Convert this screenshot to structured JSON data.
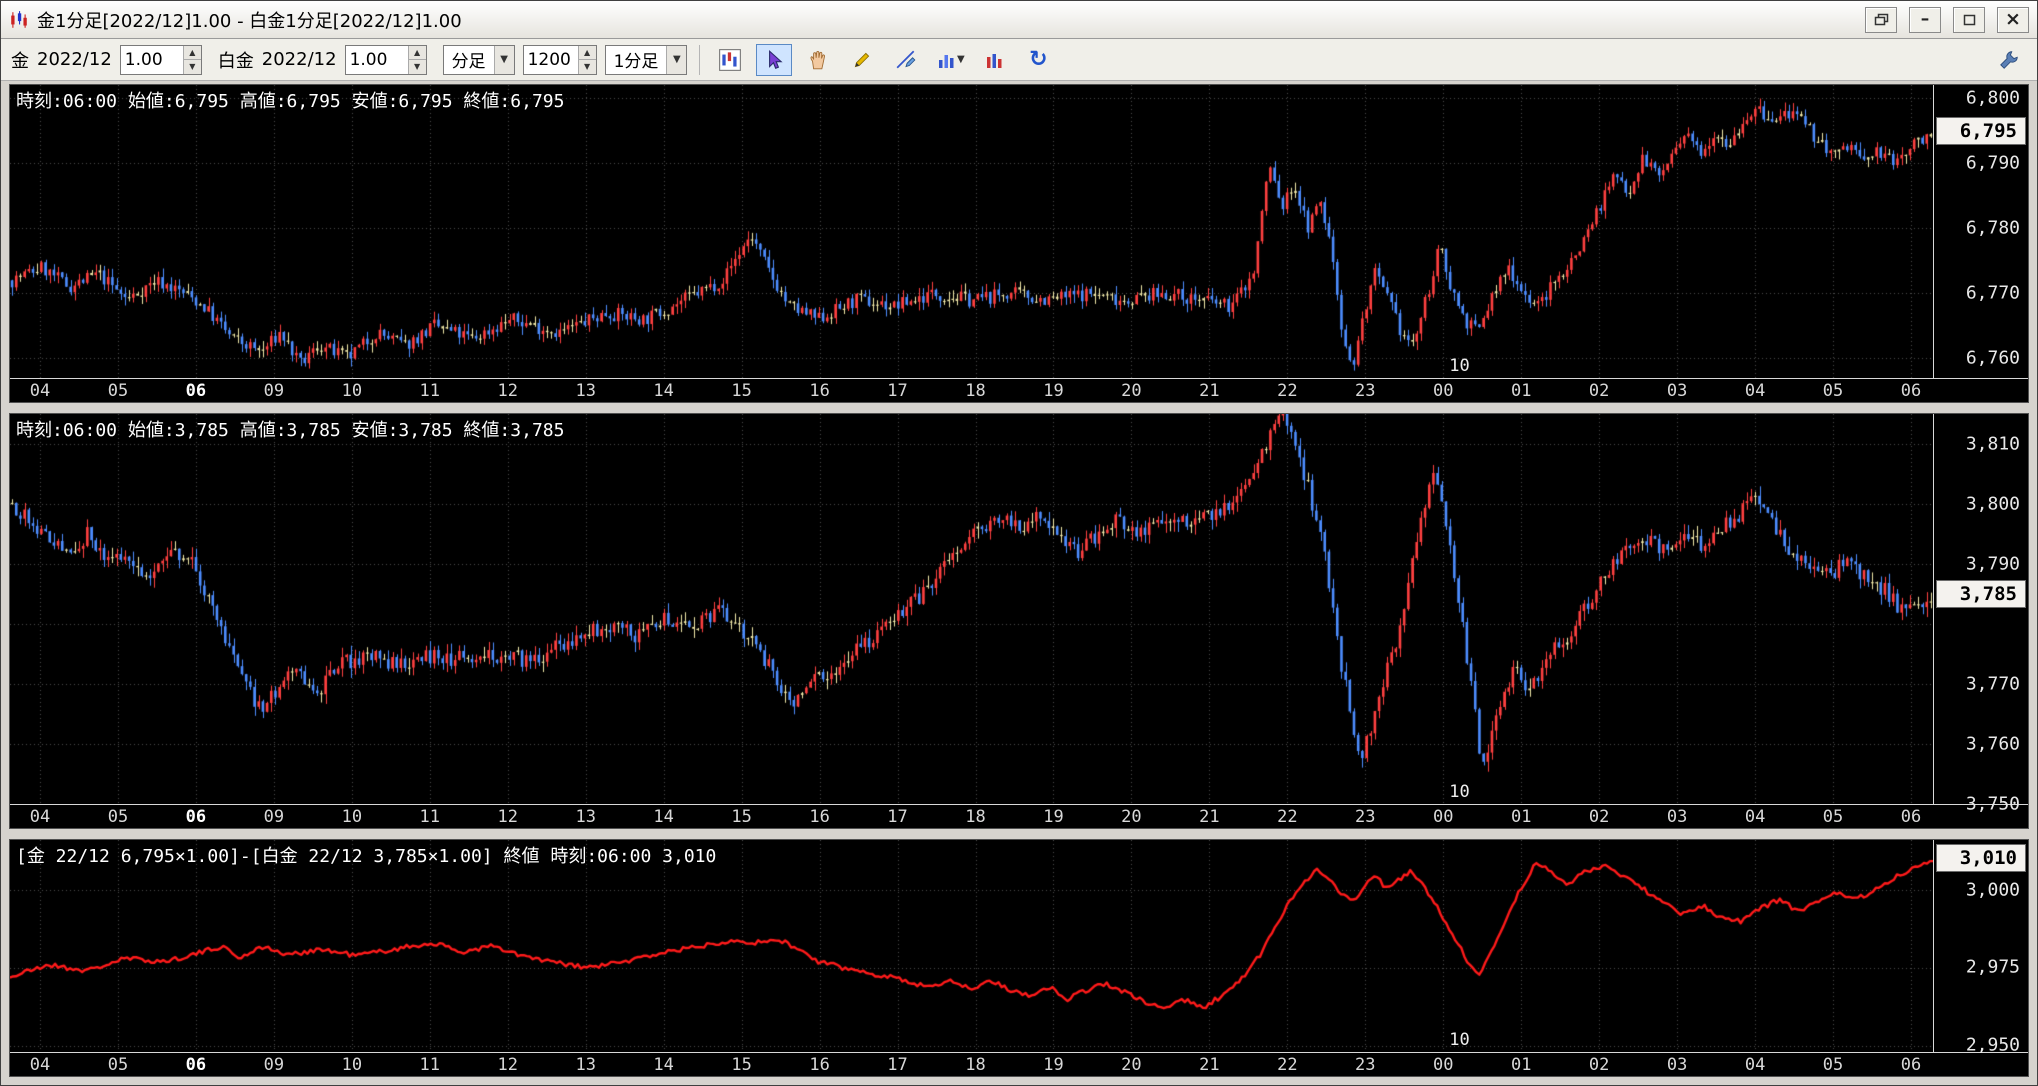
{
  "window": {
    "title": "金1分足[2022/12]1.00 - 白金1分足[2022/12]1.00"
  },
  "icons": {
    "caret_down": "▼",
    "spin_up": "▲",
    "spin_down": "▼",
    "refresh": "↻",
    "minimize": "–",
    "close": "×"
  },
  "toolbar": {
    "gold_label": "金",
    "gold_month": "2022/12",
    "gold_multiplier": "1.00",
    "platinum_label": "白金",
    "platinum_month": "2022/12",
    "platinum_multiplier": "1.00",
    "bar_type": "分足",
    "bar_count": "1200",
    "bar_interval": "1分足"
  },
  "colors": {
    "candle_up": "#ff4040",
    "candle_down": "#4d8dff",
    "candle_flat": "#f0e8a8",
    "spread_line": "#ff1a1a",
    "grid": "#4d4d4d",
    "panel_bg": "#000000",
    "marker_bg": "#f4f2ee",
    "selected_tool_bg": "#cfe4ff"
  },
  "x_axis": {
    "labels": [
      "04",
      "05",
      "06",
      "09",
      "10",
      "11",
      "12",
      "13",
      "14",
      "15",
      "16",
      "17",
      "18",
      "19",
      "20",
      "21",
      "22",
      "23",
      "00",
      "01",
      "02",
      "03",
      "04",
      "05",
      "06"
    ],
    "emphasized_index": 2,
    "date_marker": {
      "label": "10",
      "index": 18
    }
  },
  "chart_data": [
    {
      "id": "gold",
      "type": "candlestick",
      "title_info": "時刻:06:00 始値:6,795 高値:6,795 安値:6,795 終値:6,795",
      "y_ticks": [
        6800,
        6790,
        6780,
        6770,
        6760
      ],
      "grid_values": [
        6800,
        6790,
        6780,
        6770,
        6760
      ],
      "y_range": [
        6757,
        6802
      ],
      "last_price": 6795,
      "last_price_label": "6,795",
      "candle_count": 460,
      "noise": 1.1,
      "seed": 7,
      "keypoints": [
        [
          0,
          6772
        ],
        [
          0.015,
          6774
        ],
        [
          0.03,
          6771
        ],
        [
          0.045,
          6773
        ],
        [
          0.06,
          6769
        ],
        [
          0.075,
          6772
        ],
        [
          0.09,
          6770
        ],
        [
          0.1,
          6768
        ],
        [
          0.115,
          6763
        ],
        [
          0.13,
          6761
        ],
        [
          0.14,
          6764
        ],
        [
          0.15,
          6759
        ],
        [
          0.16,
          6762
        ],
        [
          0.175,
          6760
        ],
        [
          0.19,
          6764
        ],
        [
          0.205,
          6762
        ],
        [
          0.22,
          6765
        ],
        [
          0.24,
          6763
        ],
        [
          0.26,
          6766
        ],
        [
          0.285,
          6764
        ],
        [
          0.31,
          6767
        ],
        [
          0.33,
          6766
        ],
        [
          0.35,
          6769
        ],
        [
          0.37,
          6772
        ],
        [
          0.385,
          6779
        ],
        [
          0.395,
          6773
        ],
        [
          0.405,
          6768
        ],
        [
          0.42,
          6766
        ],
        [
          0.44,
          6769
        ],
        [
          0.46,
          6768
        ],
        [
          0.48,
          6770
        ],
        [
          0.5,
          6769
        ],
        [
          0.52,
          6770
        ],
        [
          0.54,
          6769
        ],
        [
          0.56,
          6770
        ],
        [
          0.58,
          6769
        ],
        [
          0.6,
          6770
        ],
        [
          0.62,
          6769
        ],
        [
          0.635,
          6768
        ],
        [
          0.647,
          6773
        ],
        [
          0.655,
          6790
        ],
        [
          0.662,
          6783
        ],
        [
          0.668,
          6787
        ],
        [
          0.675,
          6780
        ],
        [
          0.682,
          6784
        ],
        [
          0.688,
          6776
        ],
        [
          0.693,
          6765
        ],
        [
          0.698,
          6758
        ],
        [
          0.704,
          6766
        ],
        [
          0.71,
          6773
        ],
        [
          0.717,
          6769
        ],
        [
          0.724,
          6764
        ],
        [
          0.73,
          6762
        ],
        [
          0.737,
          6769
        ],
        [
          0.744,
          6777
        ],
        [
          0.75,
          6771
        ],
        [
          0.757,
          6766
        ],
        [
          0.764,
          6764
        ],
        [
          0.772,
          6770
        ],
        [
          0.78,
          6774
        ],
        [
          0.788,
          6770
        ],
        [
          0.795,
          6768
        ],
        [
          0.805,
          6772
        ],
        [
          0.815,
          6776
        ],
        [
          0.825,
          6782
        ],
        [
          0.835,
          6788
        ],
        [
          0.843,
          6786
        ],
        [
          0.85,
          6791
        ],
        [
          0.858,
          6788
        ],
        [
          0.865,
          6791
        ],
        [
          0.872,
          6794
        ],
        [
          0.88,
          6792
        ],
        [
          0.888,
          6795
        ],
        [
          0.895,
          6793
        ],
        [
          0.903,
          6797
        ],
        [
          0.91,
          6798
        ],
        [
          0.918,
          6796
        ],
        [
          0.925,
          6798
        ],
        [
          0.933,
          6796
        ],
        [
          0.94,
          6794
        ],
        [
          0.95,
          6791
        ],
        [
          0.958,
          6793
        ],
        [
          0.965,
          6790
        ],
        [
          0.972,
          6792
        ],
        [
          0.98,
          6790
        ],
        [
          0.988,
          6792
        ],
        [
          1,
          6795
        ]
      ]
    },
    {
      "id": "platinum",
      "type": "candlestick",
      "title_info": "時刻:06:00 始値:3,785 高値:3,785 安値:3,785 終値:3,785",
      "y_ticks": [
        3810,
        3800,
        3790,
        3770,
        3760,
        3750
      ],
      "grid_values": [
        3810,
        3800,
        3790,
        3780,
        3770,
        3760,
        3750
      ],
      "y_range": [
        3750,
        3815
      ],
      "last_price": 3785,
      "last_price_label": "3,785",
      "candle_count": 460,
      "noise": 1.4,
      "seed": 13,
      "keypoints": [
        [
          0,
          3800
        ],
        [
          0.01,
          3797
        ],
        [
          0.02,
          3794
        ],
        [
          0.03,
          3792
        ],
        [
          0.04,
          3795
        ],
        [
          0.05,
          3790
        ],
        [
          0.06,
          3792
        ],
        [
          0.07,
          3788
        ],
        [
          0.08,
          3791
        ],
        [
          0.09,
          3792
        ],
        [
          0.1,
          3786
        ],
        [
          0.11,
          3778
        ],
        [
          0.12,
          3771
        ],
        [
          0.13,
          3765
        ],
        [
          0.14,
          3770
        ],
        [
          0.15,
          3772
        ],
        [
          0.16,
          3769
        ],
        [
          0.17,
          3773
        ],
        [
          0.185,
          3775
        ],
        [
          0.2,
          3773
        ],
        [
          0.215,
          3775
        ],
        [
          0.23,
          3774
        ],
        [
          0.25,
          3775
        ],
        [
          0.27,
          3774
        ],
        [
          0.29,
          3777
        ],
        [
          0.31,
          3780
        ],
        [
          0.325,
          3778
        ],
        [
          0.34,
          3781
        ],
        [
          0.355,
          3780
        ],
        [
          0.37,
          3782
        ],
        [
          0.38,
          3779
        ],
        [
          0.39,
          3775
        ],
        [
          0.4,
          3770
        ],
        [
          0.407,
          3766
        ],
        [
          0.415,
          3770
        ],
        [
          0.43,
          3773
        ],
        [
          0.445,
          3777
        ],
        [
          0.46,
          3781
        ],
        [
          0.475,
          3785
        ],
        [
          0.49,
          3791
        ],
        [
          0.505,
          3796
        ],
        [
          0.515,
          3798
        ],
        [
          0.525,
          3796
        ],
        [
          0.535,
          3798
        ],
        [
          0.545,
          3794
        ],
        [
          0.555,
          3792
        ],
        [
          0.565,
          3795
        ],
        [
          0.575,
          3797
        ],
        [
          0.585,
          3795
        ],
        [
          0.6,
          3798
        ],
        [
          0.615,
          3797
        ],
        [
          0.63,
          3799
        ],
        [
          0.64,
          3802
        ],
        [
          0.65,
          3807
        ],
        [
          0.657,
          3812
        ],
        [
          0.663,
          3815
        ],
        [
          0.67,
          3808
        ],
        [
          0.677,
          3801
        ],
        [
          0.684,
          3792
        ],
        [
          0.69,
          3778
        ],
        [
          0.697,
          3766
        ],
        [
          0.703,
          3758
        ],
        [
          0.71,
          3765
        ],
        [
          0.717,
          3773
        ],
        [
          0.724,
          3780
        ],
        [
          0.73,
          3790
        ],
        [
          0.736,
          3800
        ],
        [
          0.741,
          3806
        ],
        [
          0.747,
          3798
        ],
        [
          0.753,
          3786
        ],
        [
          0.76,
          3770
        ],
        [
          0.766,
          3757
        ],
        [
          0.772,
          3762
        ],
        [
          0.778,
          3769
        ],
        [
          0.784,
          3773
        ],
        [
          0.79,
          3769
        ],
        [
          0.8,
          3774
        ],
        [
          0.81,
          3778
        ],
        [
          0.82,
          3783
        ],
        [
          0.83,
          3788
        ],
        [
          0.84,
          3792
        ],
        [
          0.85,
          3795
        ],
        [
          0.86,
          3792
        ],
        [
          0.87,
          3795
        ],
        [
          0.88,
          3793
        ],
        [
          0.89,
          3796
        ],
        [
          0.9,
          3798
        ],
        [
          0.908,
          3801
        ],
        [
          0.916,
          3797
        ],
        [
          0.925,
          3793
        ],
        [
          0.935,
          3790
        ],
        [
          0.945,
          3788
        ],
        [
          0.955,
          3790
        ],
        [
          0.965,
          3788
        ],
        [
          0.975,
          3786
        ],
        [
          0.985,
          3782
        ],
        [
          1,
          3785
        ]
      ]
    },
    {
      "id": "spread",
      "type": "line",
      "title_info": "[金 22/12 6,795×1.00]-[白金 22/12 3,785×1.00] 終値 時刻:06:00 3,010",
      "y_ticks": [
        3000,
        2975,
        2950
      ],
      "grid_values": [
        3000,
        2975,
        2950
      ],
      "y_range": [
        2948,
        3016
      ],
      "last_price": 3010,
      "last_price_label": "3,010",
      "noise": 0.8,
      "seed": 21,
      "keypoints": [
        [
          0,
          2972
        ],
        [
          0.02,
          2976
        ],
        [
          0.04,
          2974
        ],
        [
          0.06,
          2978
        ],
        [
          0.08,
          2977
        ],
        [
          0.1,
          2980
        ],
        [
          0.11,
          2982
        ],
        [
          0.12,
          2978
        ],
        [
          0.13,
          2982
        ],
        [
          0.145,
          2979
        ],
        [
          0.16,
          2981
        ],
        [
          0.18,
          2979
        ],
        [
          0.2,
          2981
        ],
        [
          0.22,
          2983
        ],
        [
          0.235,
          2980
        ],
        [
          0.25,
          2982
        ],
        [
          0.265,
          2979
        ],
        [
          0.28,
          2977
        ],
        [
          0.3,
          2975
        ],
        [
          0.32,
          2977
        ],
        [
          0.34,
          2980
        ],
        [
          0.36,
          2982
        ],
        [
          0.375,
          2984
        ],
        [
          0.39,
          2983
        ],
        [
          0.4,
          2984
        ],
        [
          0.41,
          2981
        ],
        [
          0.42,
          2977
        ],
        [
          0.44,
          2974
        ],
        [
          0.46,
          2972
        ],
        [
          0.475,
          2969
        ],
        [
          0.49,
          2971
        ],
        [
          0.5,
          2968
        ],
        [
          0.51,
          2971
        ],
        [
          0.52,
          2968
        ],
        [
          0.53,
          2966
        ],
        [
          0.54,
          2969
        ],
        [
          0.55,
          2965
        ],
        [
          0.56,
          2968
        ],
        [
          0.57,
          2970
        ],
        [
          0.58,
          2967
        ],
        [
          0.59,
          2964
        ],
        [
          0.6,
          2962
        ],
        [
          0.61,
          2965
        ],
        [
          0.62,
          2962
        ],
        [
          0.63,
          2966
        ],
        [
          0.64,
          2971
        ],
        [
          0.65,
          2979
        ],
        [
          0.658,
          2988
        ],
        [
          0.665,
          2996
        ],
        [
          0.672,
          3002
        ],
        [
          0.68,
          3007
        ],
        [
          0.686,
          3003
        ],
        [
          0.692,
          2999
        ],
        [
          0.698,
          2996
        ],
        [
          0.704,
          3001
        ],
        [
          0.71,
          3005
        ],
        [
          0.716,
          3000
        ],
        [
          0.722,
          3003
        ],
        [
          0.728,
          3006
        ],
        [
          0.734,
          3002
        ],
        [
          0.74,
          2997
        ],
        [
          0.746,
          2990
        ],
        [
          0.752,
          2984
        ],
        [
          0.758,
          2977
        ],
        [
          0.764,
          2972
        ],
        [
          0.77,
          2980
        ],
        [
          0.776,
          2988
        ],
        [
          0.782,
          2996
        ],
        [
          0.788,
          3003
        ],
        [
          0.794,
          3009
        ],
        [
          0.8,
          3006
        ],
        [
          0.81,
          3002
        ],
        [
          0.82,
          3006
        ],
        [
          0.83,
          3008
        ],
        [
          0.84,
          3004
        ],
        [
          0.85,
          3000
        ],
        [
          0.86,
          2996
        ],
        [
          0.87,
          2992
        ],
        [
          0.88,
          2995
        ],
        [
          0.89,
          2991
        ],
        [
          0.9,
          2990
        ],
        [
          0.91,
          2994
        ],
        [
          0.92,
          2997
        ],
        [
          0.93,
          2993
        ],
        [
          0.94,
          2996
        ],
        [
          0.95,
          2999
        ],
        [
          0.96,
          2997
        ],
        [
          0.97,
          3000
        ],
        [
          0.98,
          3004
        ],
        [
          0.99,
          3007
        ],
        [
          1,
          3010
        ]
      ]
    }
  ]
}
